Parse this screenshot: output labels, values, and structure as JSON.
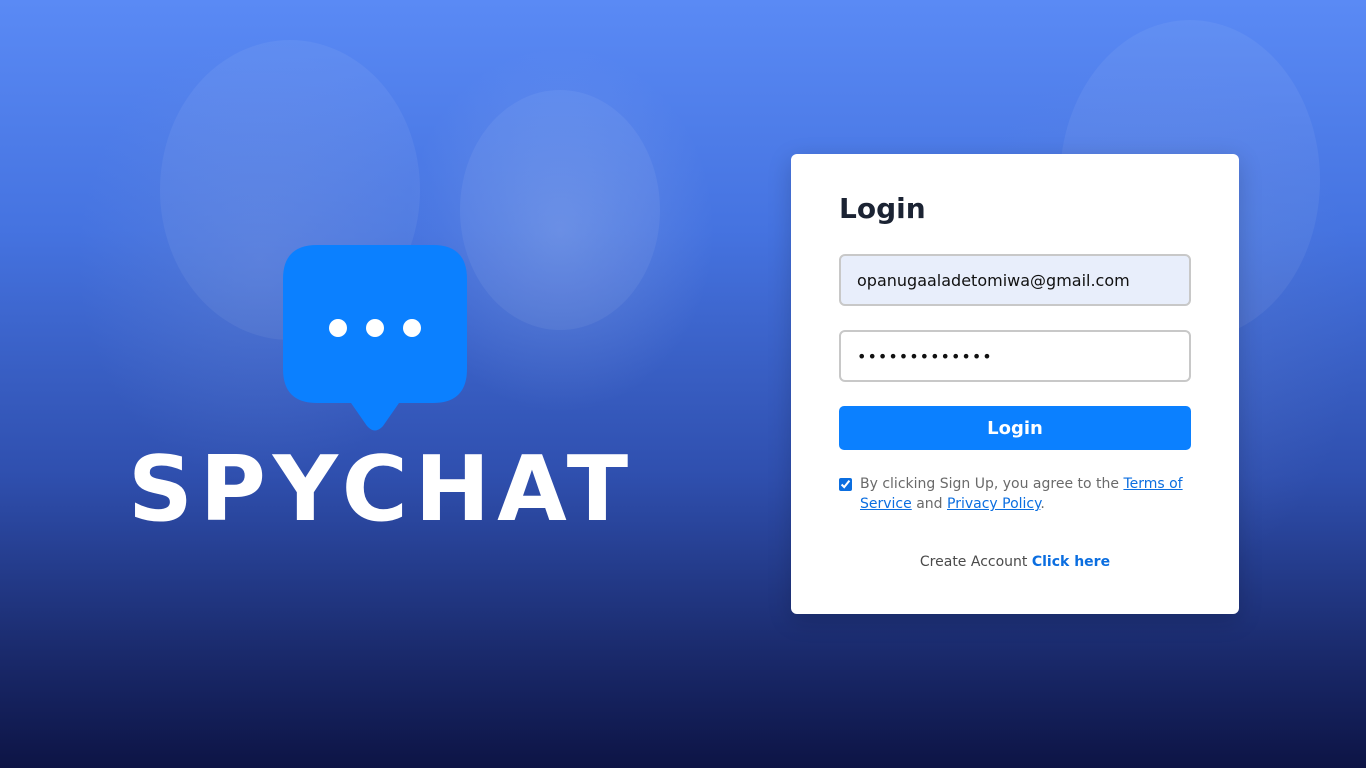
{
  "brand": {
    "name": "SPYCHAT",
    "logo_icon": "chat-bubble-icon",
    "logo_color": "#0b80ff"
  },
  "login": {
    "title": "Login",
    "email_value": "opanugaaladetomiwa@gmail.com",
    "password_value": "•••••••••••••",
    "submit_label": "Login",
    "terms": {
      "checked": true,
      "text_before": "By clicking Sign Up, you agree to the ",
      "terms_link": "Terms of Service",
      "text_middle": " and ",
      "privacy_link": "Privacy Policy",
      "text_after": "."
    },
    "create_account": {
      "text": "Create Account ",
      "link": "Click here"
    }
  },
  "colors": {
    "accent": "#0b80ff",
    "link": "#0b6ee0",
    "title": "#1b2333"
  }
}
